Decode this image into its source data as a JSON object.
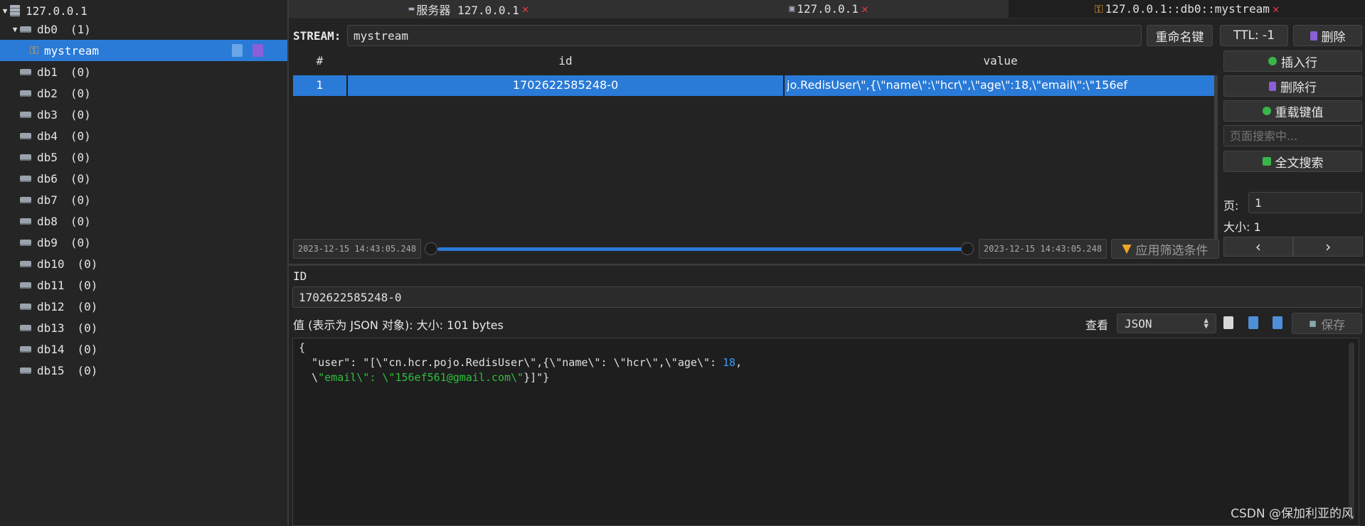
{
  "sidebar": {
    "server": {
      "label": "127.0.0.1"
    },
    "db0": {
      "label": "db0",
      "count": "(1)"
    },
    "selected_key": {
      "label": "mystream"
    },
    "dbs": [
      {
        "label": "db1",
        "count": "(0)"
      },
      {
        "label": "db2",
        "count": "(0)"
      },
      {
        "label": "db3",
        "count": "(0)"
      },
      {
        "label": "db4",
        "count": "(0)"
      },
      {
        "label": "db5",
        "count": "(0)"
      },
      {
        "label": "db6",
        "count": "(0)"
      },
      {
        "label": "db7",
        "count": "(0)"
      },
      {
        "label": "db8",
        "count": "(0)"
      },
      {
        "label": "db9",
        "count": "(0)"
      },
      {
        "label": "db10",
        "count": "(0)"
      },
      {
        "label": "db11",
        "count": "(0)"
      },
      {
        "label": "db12",
        "count": "(0)"
      },
      {
        "label": "db13",
        "count": "(0)"
      },
      {
        "label": "db14",
        "count": "(0)"
      },
      {
        "label": "db15",
        "count": "(0)"
      }
    ]
  },
  "tabs": [
    {
      "label": "服务器 127.0.0.1"
    },
    {
      "label": "127.0.0.1"
    },
    {
      "label": "127.0.0.1::db0::mystream"
    }
  ],
  "key_header": {
    "type_label": "STREAM:",
    "key_name": "mystream",
    "rename_label": "重命名键",
    "ttl_label": "TTL: -1",
    "delete_label": "删除"
  },
  "table": {
    "headers": [
      "#",
      "id",
      "value"
    ],
    "rows": [
      {
        "num": "1",
        "id": "1702622585248-0",
        "value": "jo.RedisUser\\\",{\\\"name\\\":\\\"hcr\\\",\\\"age\\\":18,\\\"email\\\":\\\"156ef"
      }
    ]
  },
  "actions": {
    "insert_row": "插入行",
    "delete_row": "删除行",
    "reload": "重载键值",
    "search_placeholder": "页面搜索中...",
    "full_search": "全文搜索",
    "page_label": "页:",
    "page_value": "1",
    "size_label": "大小: 1",
    "prev": "‹",
    "next": "›"
  },
  "filter": {
    "start": "2023-12-15 14:43:05.248",
    "end": "2023-12-15 14:43:05.248",
    "apply": "应用筛选条件"
  },
  "detail": {
    "id_label": "ID",
    "id_value": "1702622585248-0",
    "value_label": "值 (表示为 JSON 对象): 大小: 101 bytes",
    "view_label": "查看",
    "format": "JSON",
    "save": "保存"
  },
  "editor": {
    "line1": "{",
    "line2_key": "  \"user\": \"[\\\"cn.hcr.pojo.RedisUser\\\",{\\\"name\\\": \\\"hcr\\\",\\\"age\\\": ",
    "line2_num": "18",
    "line2_end": ",",
    "line3_prefix": "  \\",
    "line3_str": "\"email\\\": \\\"156ef561@gmail.com\\\"",
    "line3_end": "}]\"}"
  },
  "watermark": "CSDN @保加利亚的风",
  "colors": {
    "accent": "#2a7ad7",
    "close": "#e23b3b",
    "key": "#f0a32a",
    "number": "#3a9cf2",
    "string": "#2fbf3c"
  }
}
